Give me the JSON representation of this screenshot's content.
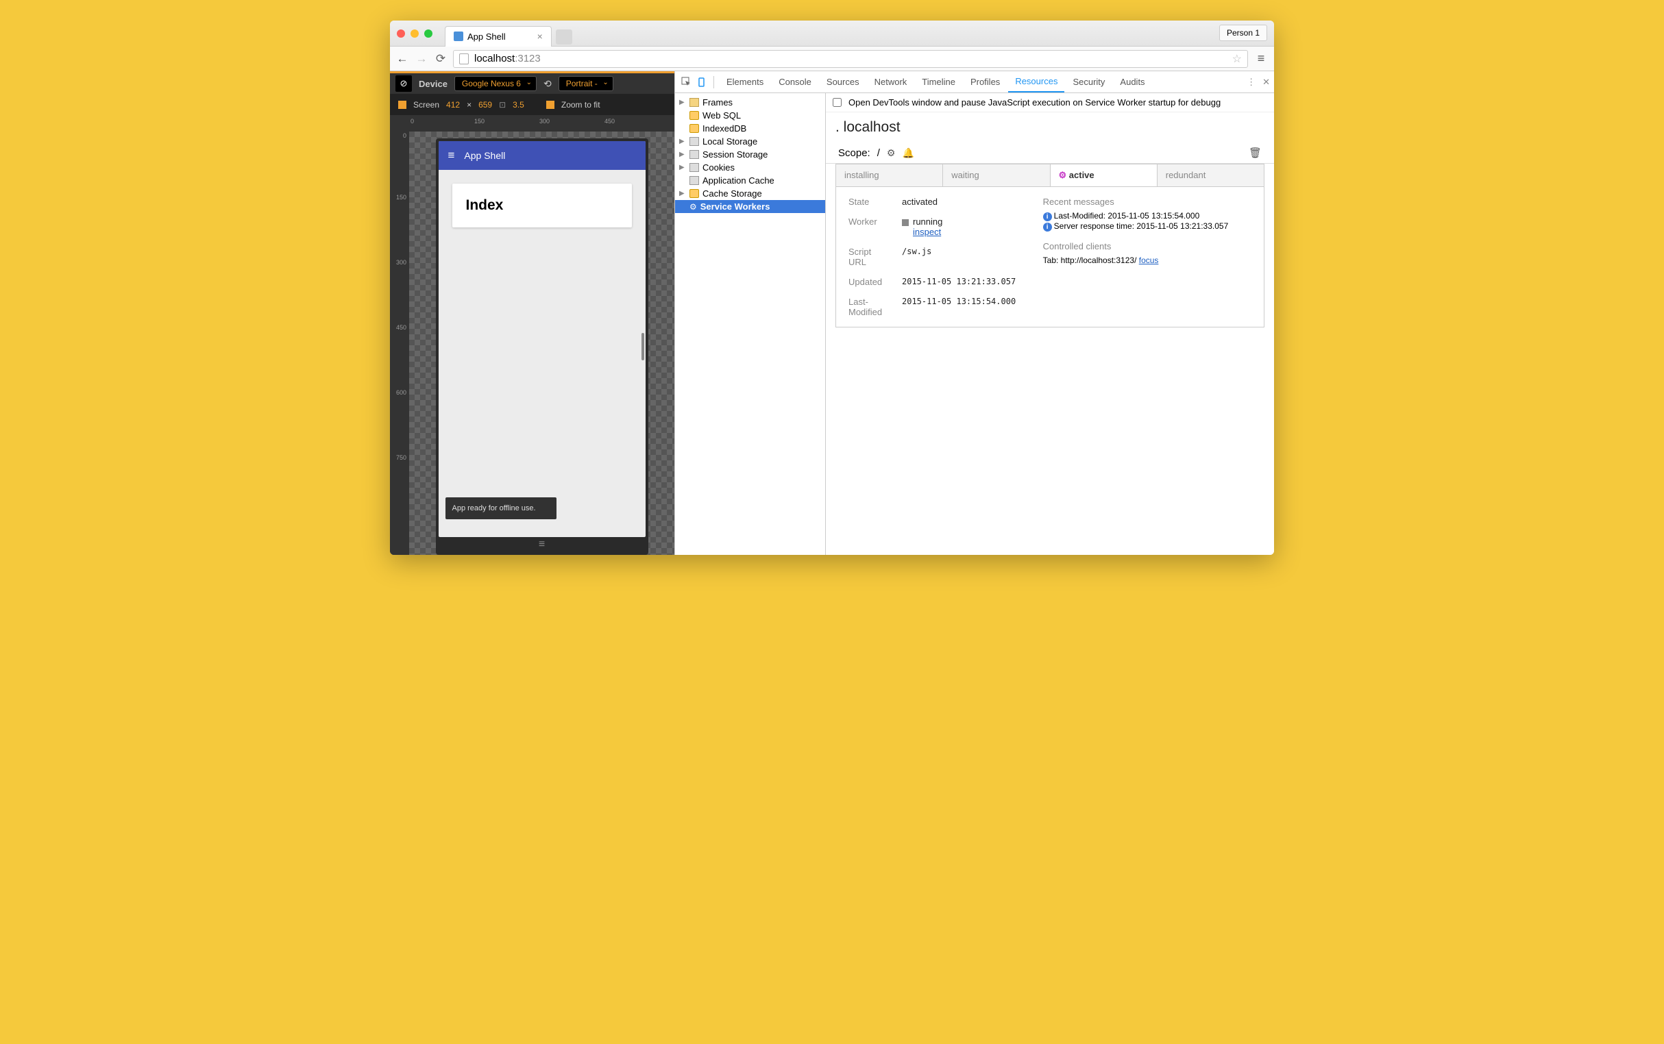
{
  "browser": {
    "tab_title": "App Shell",
    "person": "Person 1",
    "url_host": "localhost",
    "url_port": ":3123"
  },
  "device_toolbar": {
    "device_label": "Device",
    "device_value": "Google Nexus 6",
    "orientation": "Portrait -",
    "screen_label": "Screen",
    "width": "412",
    "times": "×",
    "height": "659",
    "dpr": "3.5",
    "zoom": "Zoom to fit"
  },
  "ruler": {
    "h": [
      "0",
      "150",
      "300",
      "450"
    ],
    "v": [
      "0",
      "150",
      "300",
      "450",
      "600",
      "750"
    ]
  },
  "app": {
    "title": "App Shell",
    "card": "Index",
    "toast": "App ready for offline use."
  },
  "devtools": {
    "tabs": [
      "Elements",
      "Console",
      "Sources",
      "Network",
      "Timeline",
      "Profiles",
      "Resources",
      "Security",
      "Audits"
    ],
    "active_tab": "Resources",
    "tree": [
      "Frames",
      "Web SQL",
      "IndexedDB",
      "Local Storage",
      "Session Storage",
      "Cookies",
      "Application Cache",
      "Cache Storage",
      "Service Workers"
    ],
    "pause_msg": "Open DevTools window and pause JavaScript execution on Service Worker startup for debugg",
    "origin": "localhost",
    "scope_label": "Scope:",
    "scope_value": "/",
    "status_tabs": [
      "installing",
      "waiting",
      "active",
      "redundant"
    ],
    "sw": {
      "state_l": "State",
      "state_v": "activated",
      "worker_l": "Worker",
      "worker_v": "running",
      "worker_link": "inspect",
      "script_l": "Script URL",
      "script_v": "/sw.js",
      "updated_l": "Updated",
      "updated_v": "2015-11-05 13:21:33.057",
      "lastmod_l": "Last-Modified",
      "lastmod_v": "2015-11-05 13:15:54.000",
      "msgs_h": "Recent messages",
      "msg1": "Last-Modified: 2015-11-05 13:15:54.000",
      "msg2": "Server response time: 2015-11-05 13:21:33.057",
      "clients_h": "Controlled clients",
      "client": "Tab: http://localhost:3123/ ",
      "client_link": "focus"
    }
  }
}
